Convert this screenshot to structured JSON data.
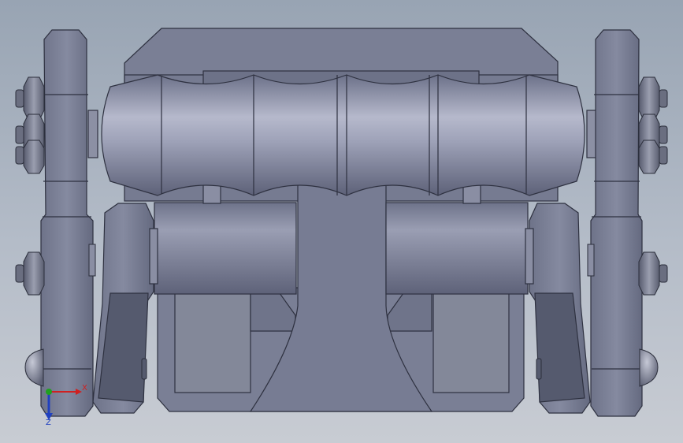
{
  "viewport": {
    "background_top": "#98a4b3",
    "background_bottom": "#c8ccd3",
    "part_color": "#7c8196"
  },
  "triad": {
    "x_label": "X",
    "z_label": "Z",
    "x_color": "#d02020",
    "y_color": "#20a020",
    "z_color": "#2040c0"
  }
}
